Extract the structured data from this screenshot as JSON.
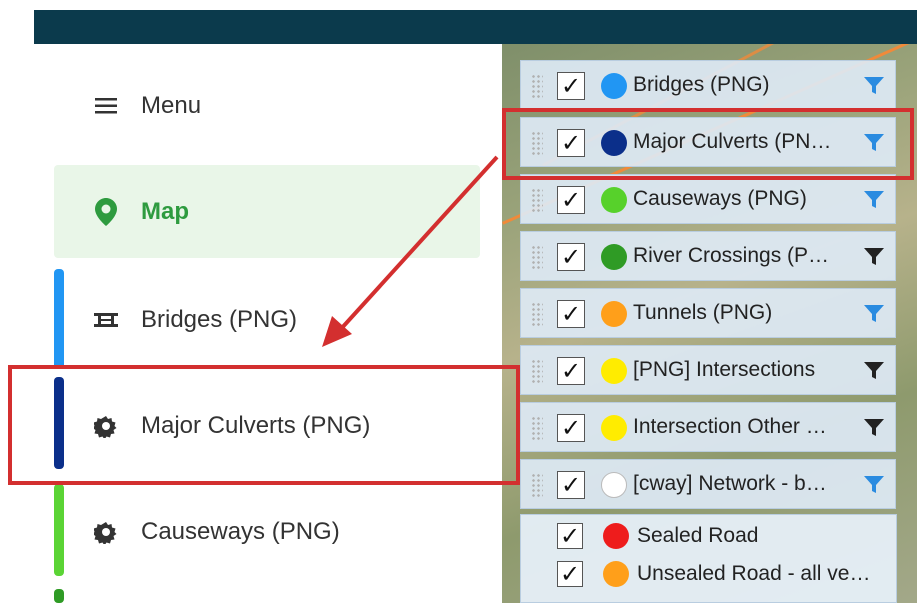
{
  "sidebar": {
    "menu_label": "Menu",
    "items": [
      {
        "label": "Map",
        "icon": "map-pin-icon",
        "color": "#2e9b3f"
      },
      {
        "label": "Bridges (PNG)",
        "icon": "bridge-icon",
        "stripe": "#2196f3"
      },
      {
        "label": "Major Culverts (PNG)",
        "icon": "gear-icon",
        "stripe": "#0b2f8a"
      },
      {
        "label": "Causeways (PNG)",
        "icon": "gear-icon",
        "stripe": "#5bd435"
      }
    ]
  },
  "layers": [
    {
      "label": "Bridges (PNG)",
      "dot": "#2196f3",
      "filter": "#2a8be0"
    },
    {
      "label": "Major Culverts (PN…",
      "dot": "#0b2f8a",
      "filter": "#2a8be0"
    },
    {
      "label": "Causeways (PNG)",
      "dot": "#57d12b",
      "filter": "#2a8be0"
    },
    {
      "label": "River Crossings (P…",
      "dot": "#2f9b25",
      "filter": "#222222"
    },
    {
      "label": "Tunnels (PNG)",
      "dot": "#ff9f1a",
      "filter": "#2a8be0"
    },
    {
      "label": "[PNG] Intersections",
      "dot": "#ffec00",
      "filter": "#222222"
    },
    {
      "label": "Intersection Other …",
      "dot": "#ffec00",
      "filter": "#222222"
    },
    {
      "label": "[cway] Network - b…",
      "dot": "#ffffff",
      "filter": "#2a8be0"
    }
  ],
  "legend": [
    {
      "label": "Sealed Road",
      "dot": "#ee1c1c"
    },
    {
      "label": "Unsealed Road - all ve…",
      "dot": "#ff9f1a"
    }
  ]
}
